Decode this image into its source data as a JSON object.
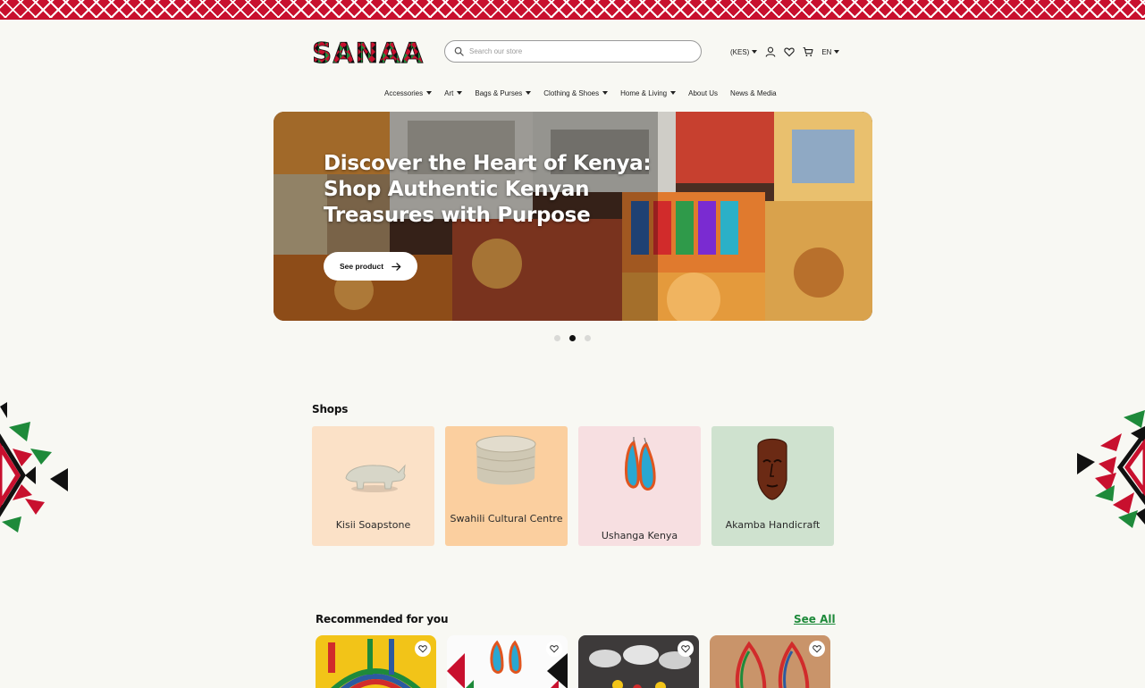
{
  "brand": {
    "logo_text": "SANAA"
  },
  "header": {
    "search_placeholder": "Search our store",
    "currency": "(KES)",
    "language": "EN"
  },
  "nav": {
    "items": [
      {
        "label": "Accessories",
        "dropdown": true
      },
      {
        "label": "Art",
        "dropdown": true
      },
      {
        "label": "Bags & Purses",
        "dropdown": true
      },
      {
        "label": "Clothing & Shoes",
        "dropdown": true
      },
      {
        "label": "Home & Living",
        "dropdown": true
      },
      {
        "label": "About Us",
        "dropdown": false
      },
      {
        "label": "News & Media",
        "dropdown": false
      }
    ]
  },
  "hero": {
    "title": "Discover the Heart of Kenya: Shop Authentic Kenyan Treasures with Purpose",
    "button_label": "See product",
    "slides": 3,
    "active_slide": 2
  },
  "shops": {
    "title": "Shops",
    "items": [
      {
        "name": "Kisii Soapstone",
        "bg": "#fbe1c7"
      },
      {
        "name": "Swahili Cultural Centre",
        "bg": "#fbcf9f"
      },
      {
        "name": "Ushanga Kenya",
        "bg": "#f7dfe1"
      },
      {
        "name": "Akamba Handicraft",
        "bg": "#cfe2cf"
      }
    ]
  },
  "recommended": {
    "title": "Recommended for you",
    "see_all": "See All"
  },
  "colors": {
    "background": "#f8f8f3",
    "brand_red": "#c8102e",
    "brand_green": "#1e8a3a",
    "text": "#1a1a1a"
  }
}
